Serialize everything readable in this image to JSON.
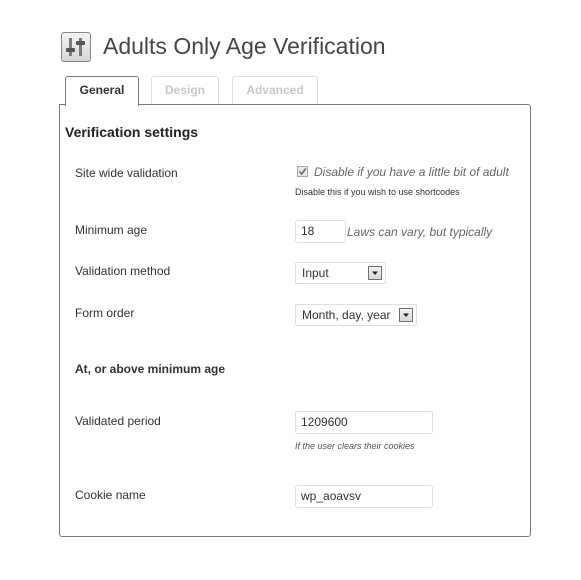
{
  "header": {
    "title": "Adults Only Age Verification",
    "icon": "sliders-icon"
  },
  "tabs": [
    {
      "label": "General",
      "active": true
    },
    {
      "label": "Design",
      "active": false
    },
    {
      "label": "Advanced",
      "active": false
    }
  ],
  "section": {
    "heading": "Verification settings"
  },
  "fields": {
    "site_wide": {
      "label": "Site wide validation",
      "checked": true,
      "description": "Disable if you have a little bit of adult",
      "note": "Disable this if you wish to use shortcodes"
    },
    "minimum_age": {
      "label": "Minimum age",
      "value": "18",
      "hint": "Laws can vary, but typically"
    },
    "validation_method": {
      "label": "Validation method",
      "selected": "Input"
    },
    "form_order": {
      "label": "Form order",
      "selected": "Month, day, year"
    },
    "subheading": "At, or above minimum age",
    "validated_period": {
      "label": "Validated period",
      "value": "1209600",
      "note": "If the user clears their cookies"
    },
    "cookie_name": {
      "label": "Cookie name",
      "value": "wp_aoavsv"
    }
  }
}
